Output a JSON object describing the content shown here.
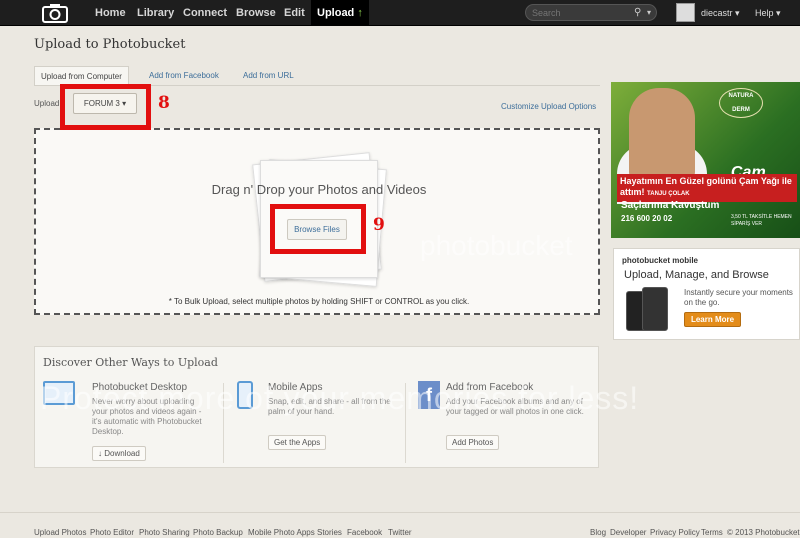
{
  "topbar": {
    "nav": [
      "Home",
      "Library",
      "Connect",
      "Browse",
      "Edit",
      "Upload"
    ],
    "search_placeholder": "Search",
    "username": "diecastr",
    "help": "Help"
  },
  "page_title": "Upload to Photobucket",
  "tabs": [
    "Upload from Computer",
    "Add from Facebook",
    "Add from URL"
  ],
  "upload_label": "Upload",
  "album_select": "FORUM 3",
  "customize_link": "Customize Upload Options",
  "annotations": {
    "label_8": "8",
    "label_9": "9"
  },
  "dropzone": {
    "title": "Drag n' Drop your Photos and Videos",
    "browse_button": "Browse Files",
    "bulk_note": "* To Bulk Upload, select multiple photos by holding SHIFT or CONTROL as you click."
  },
  "watermark": {
    "brand": "photobucket",
    "slogan": "Protect more of your memories for less!"
  },
  "ad": {
    "brand": "NATURA DERM",
    "product": "Çam Yağı",
    "headline": "Hayatımın En Güzel golünü Çam Yağı ile attım!",
    "signature": "TANJU ÇOLAK",
    "sub": "Saçlarıma Kavuştum",
    "phone": "216 600 20 02",
    "offer": "3,50 TL TAKSİTLE HEMEN SİPARİŞ VER"
  },
  "promo": {
    "logo": "photobucket mobile",
    "title": "Upload, Manage, and Browse",
    "text": "Instantly secure your moments on the go.",
    "button": "Learn More"
  },
  "discover": {
    "title": "Discover Other Ways to Upload",
    "columns": [
      {
        "title": "Photobucket Desktop",
        "desc": "Never worry about uploading your photos and videos again - it's automatic with Photobucket Desktop.",
        "button": "Download"
      },
      {
        "title": "Mobile Apps",
        "desc": "Snap, edit, and share - all from the palm of your hand.",
        "button": "Get the Apps"
      },
      {
        "title": "Add from Facebook",
        "desc": "Add your Facebook albums and any of your tagged or wall photos in one click.",
        "button": "Add Photos"
      }
    ]
  },
  "footer": {
    "left": [
      "Upload Photos",
      "Photo Editor",
      "Photo Sharing",
      "Photo Backup",
      "Mobile Photo Apps",
      "Stories",
      "Facebook",
      "Twitter"
    ],
    "right": [
      "Blog",
      "Developer",
      "Privacy Policy",
      "Terms",
      "© 2013 Photobucket"
    ]
  },
  "colors": {
    "annotation_red": "#e20f0f",
    "link_blue": "#3d6e9a",
    "topbar": "#1e1e1e"
  }
}
